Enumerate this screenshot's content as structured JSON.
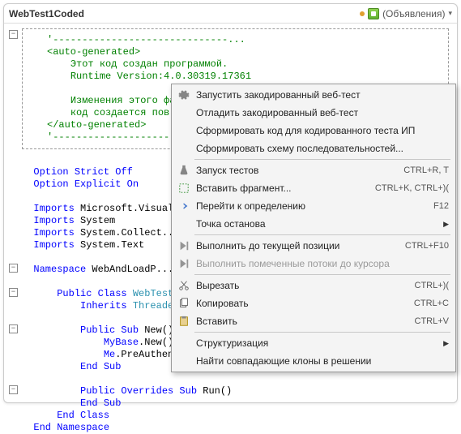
{
  "topbar": {
    "module_label": "WebTest1Coded",
    "declarations_label": "(Объявления)"
  },
  "code": {
    "autogen_open": "<auto-generated>",
    "autogen_line1": "Этот код создан программой.",
    "autogen_line2": "Runtime Version:4.0.30319.17361",
    "autogen_line3": "Изменения этого фа...",
    "autogen_line4": "код создается пов...",
    "autogen_close": "</auto-generated>",
    "opt_strict": "Option Strict Off",
    "opt_explicit": "Option Explicit On",
    "imp1_kw": "Imports",
    "imp1_v": " Microsoft.Visual...",
    "imp2_kw": "Imports",
    "imp2_v": " System",
    "imp3_kw": "Imports",
    "imp3_v": " System.Collect...",
    "imp4_kw": "Imports",
    "imp4_v": " System.Text",
    "ns_kw": "Namespace",
    "ns_v": " WebAndLoadP...",
    "cls_kw": "Public Class",
    "cls_v": " WebTest1...",
    "inh_kw": "Inherits",
    "inh_v": " Threaded...",
    "sub_new_kw": "Public Sub",
    "sub_new_v": " New()",
    "mybase_kw": "MyBase",
    "mybase_v": ".New()",
    "me_kw": "Me",
    "me_v": ".PreAuthen...",
    "end_sub": "End Sub",
    "sub_run_kw": "Public Overrides Sub",
    "sub_run_v": " Run()",
    "end_sub2": "End Sub",
    "end_class": "End Class",
    "end_ns": "End Namespace"
  },
  "menu": {
    "items": [
      {
        "icon": "gear",
        "label": "Запустить закодированный веб-тест"
      },
      {
        "icon": "",
        "label": "Отладить закодированный веб-тест"
      },
      {
        "icon": "",
        "label": "Сформировать код для кодированного теста ИП"
      },
      {
        "icon": "",
        "label": "Сформировать схему последовательностей..."
      },
      {
        "sep": true
      },
      {
        "icon": "flask",
        "label": "Запуск тестов",
        "shortcut": "CTRL+R, T"
      },
      {
        "icon": "frag",
        "label": "Вставить фрагмент...",
        "shortcut": "CTRL+K, CTRL+)("
      },
      {
        "icon": "goto",
        "label": "Перейти к определению",
        "shortcut": "F12"
      },
      {
        "icon": "",
        "label": "Точка останова",
        "submenu": true
      },
      {
        "sep": true
      },
      {
        "icon": "runto",
        "label": "Выполнить до текущей позиции",
        "shortcut": "CTRL+F10"
      },
      {
        "icon": "runto",
        "label": "Выполнить помеченные потоки до курсора",
        "disabled": true
      },
      {
        "sep": true
      },
      {
        "icon": "cut",
        "label": "Вырезать",
        "shortcut": "CTRL+)("
      },
      {
        "icon": "copy",
        "label": "Копировать",
        "shortcut": "CTRL+C"
      },
      {
        "icon": "paste",
        "label": "Вставить",
        "shortcut": "CTRL+V"
      },
      {
        "sep": true
      },
      {
        "icon": "",
        "label": "Структуризация",
        "submenu": true
      },
      {
        "icon": "",
        "label": "Найти совпадающие клоны в решении"
      }
    ]
  }
}
